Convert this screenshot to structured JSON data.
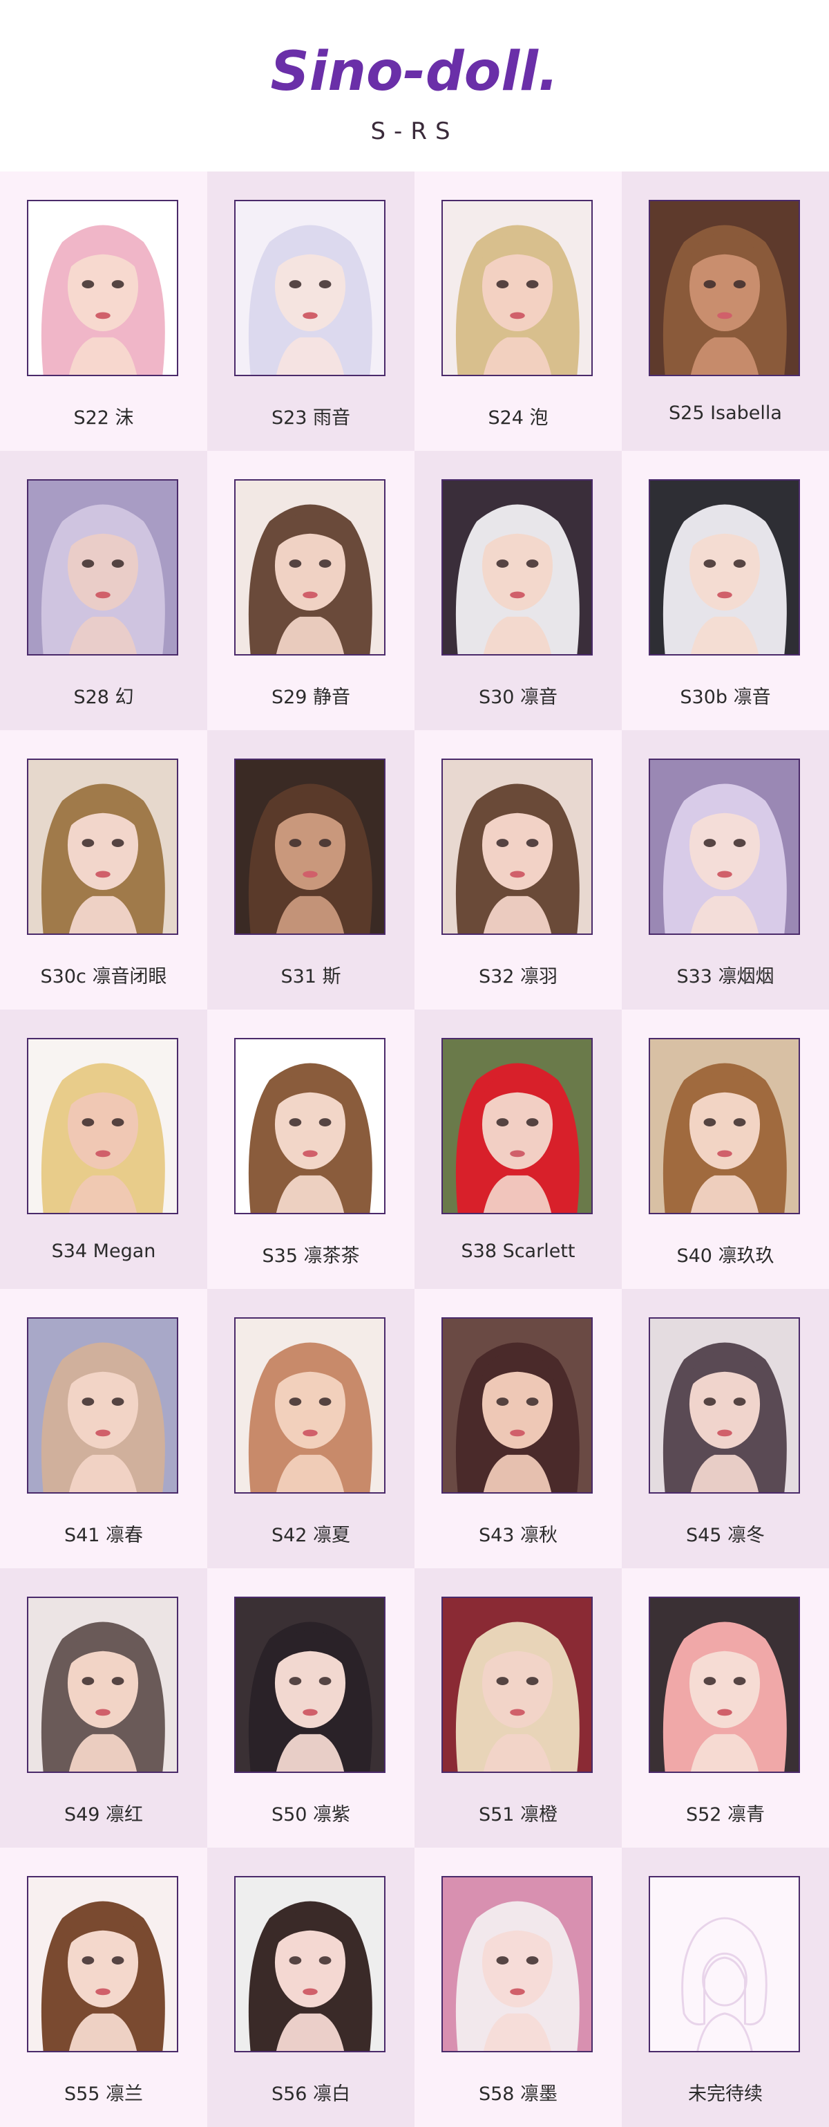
{
  "brand": {
    "logo_text": "Sino-doll.",
    "series": "S-RS",
    "accent": "#6a2fa8"
  },
  "items": [
    {
      "label": "S22 沫",
      "hair": "#f0b6c8",
      "skin": "#f7d9cf",
      "bg": "#ffffff"
    },
    {
      "label": "S23 雨音",
      "hair": "#dcd9ee",
      "skin": "#f5e4e0",
      "bg": "#f4f0f8"
    },
    {
      "label": "S24 泡",
      "hair": "#d8bf8d",
      "skin": "#f3d1c2",
      "bg": "#f4ecec"
    },
    {
      "label": "S25 Isabella",
      "hair": "#8a5a3a",
      "skin": "#c98e6e",
      "bg": "#5e3a2c"
    },
    {
      "label": "S28 幻",
      "hair": "#cfc4e0",
      "skin": "#eacdc8",
      "bg": "#a89cc4"
    },
    {
      "label": "S29 静音",
      "hair": "#6a4a3a",
      "skin": "#f0d2c4",
      "bg": "#f2e8e4"
    },
    {
      "label": "S30 凛音",
      "hair": "#e8e6ea",
      "skin": "#f3d8cc",
      "bg": "#3a2e3a"
    },
    {
      "label": "S30b 凛音",
      "hair": "#e6e4ea",
      "skin": "#f4dcd2",
      "bg": "#2e2e34"
    },
    {
      "label": "S30c 凛音闭眼",
      "hair": "#a07a4a",
      "skin": "#f2d6cb",
      "bg": "#e6d8cc"
    },
    {
      "label": "S31 斯",
      "hair": "#5a3a2a",
      "skin": "#c9987c",
      "bg": "#3a2a24"
    },
    {
      "label": "S32 凛羽",
      "hair": "#6a4a38",
      "skin": "#f2d2c6",
      "bg": "#e8d8d0"
    },
    {
      "label": "S33 凛烟烟",
      "hair": "#d8cbe8",
      "skin": "#f4ddd8",
      "bg": "#9a88b4"
    },
    {
      "label": "S34 Megan",
      "hair": "#e8cc8a",
      "skin": "#f0c8b4",
      "bg": "#f8f4f2"
    },
    {
      "label": "S35 凛茶茶",
      "hair": "#8a5c3c",
      "skin": "#f2d6c8",
      "bg": "#ffffff"
    },
    {
      "label": "S38 Scarlett",
      "hair": "#d8202a",
      "skin": "#f2cfc4",
      "bg": "#6a7a4a"
    },
    {
      "label": "S40 凛玖玖",
      "hair": "#a06a3e",
      "skin": "#f2d4c4",
      "bg": "#d8c0a4"
    },
    {
      "label": "S41 凛春",
      "hair": "#d0b09c",
      "skin": "#f2d4c6",
      "bg": "#a8a8c8"
    },
    {
      "label": "S42 凛夏",
      "hair": "#c88a6a",
      "skin": "#f2d0bc",
      "bg": "#f4ece8"
    },
    {
      "label": "S43 凛秋",
      "hair": "#4a2a2a",
      "skin": "#eec8b6",
      "bg": "#6a4a44"
    },
    {
      "label": "S45 凛冬",
      "hair": "#5a4a54",
      "skin": "#f0d4cc",
      "bg": "#e4dce0"
    },
    {
      "label": "S49 凛红",
      "hair": "#6a5a58",
      "skin": "#f2d4c6",
      "bg": "#ece4e4"
    },
    {
      "label": "S50 凛紫",
      "hair": "#2a2228",
      "skin": "#f2d8d0",
      "bg": "#3a3034"
    },
    {
      "label": "S51 凛橙",
      "hair": "#e8d4b8",
      "skin": "#f2d4c8",
      "bg": "#8a2a34"
    },
    {
      "label": "S52 凛青",
      "hair": "#f0a8a8",
      "skin": "#f6dcd4",
      "bg": "#3a3034"
    },
    {
      "label": "S55 凛兰",
      "hair": "#7a4a30",
      "skin": "#f4d8cc",
      "bg": "#f8f0f0"
    },
    {
      "label": "S56 凛白",
      "hair": "#3a2a28",
      "skin": "#f4d8d2",
      "bg": "#eeeeee"
    },
    {
      "label": "S58 凛墨",
      "hair": "#f2e8ec",
      "skin": "#f6dcd8",
      "bg": "#d890b0"
    },
    {
      "label": "未完待续",
      "hair": "#e8d4ea",
      "skin": "#f8eef8",
      "bg": "#fdf6fc",
      "placeholder": true
    }
  ]
}
